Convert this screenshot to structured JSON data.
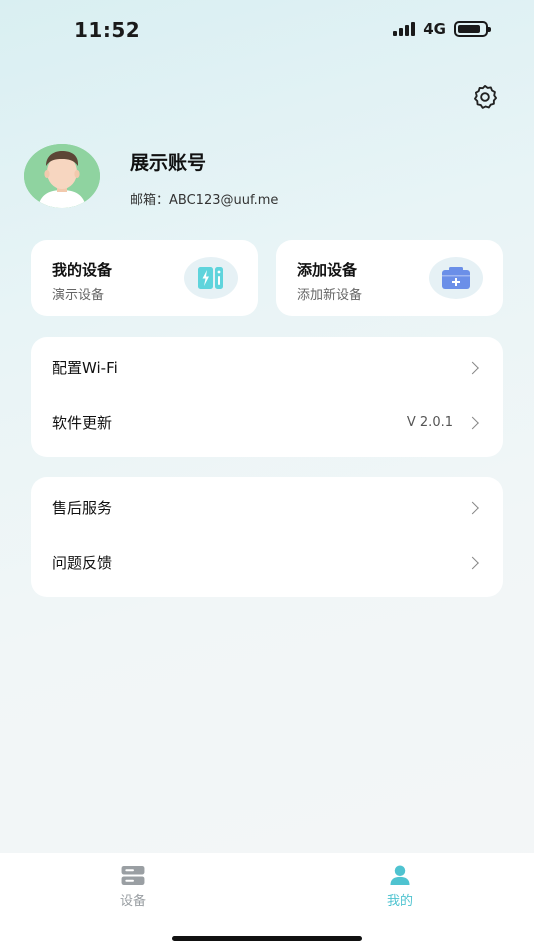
{
  "status_bar": {
    "time": "11:52",
    "network": "4G",
    "battery_percent": 85
  },
  "profile": {
    "name": "展示账号",
    "email_label": "邮箱：",
    "email": "ABC123@uuf.me"
  },
  "cards": {
    "my_devices": {
      "title": "我的设备",
      "subtitle": "演示设备",
      "icon": "battery-charging-icon"
    },
    "add_device": {
      "title": "添加设备",
      "subtitle": "添加新设备",
      "icon": "add-box-icon"
    }
  },
  "menu_group_1": {
    "wifi": {
      "label": "配置Wi-Fi"
    },
    "update": {
      "label": "软件更新",
      "value": "V 2.0.1"
    }
  },
  "menu_group_2": {
    "after_sales": {
      "label": "售后服务"
    },
    "feedback": {
      "label": "问题反馈"
    }
  },
  "tabs": {
    "devices": {
      "label": "设备",
      "icon": "server-icon",
      "active": false
    },
    "mine": {
      "label": "我的",
      "icon": "user-icon",
      "active": true
    }
  },
  "colors": {
    "accent": "#4fc3d0",
    "inactive": "#9a9fa3",
    "card_icon_bg": "#e6f1f5",
    "device_icon": "#5fd4dc",
    "add_icon": "#6b8fe8"
  }
}
